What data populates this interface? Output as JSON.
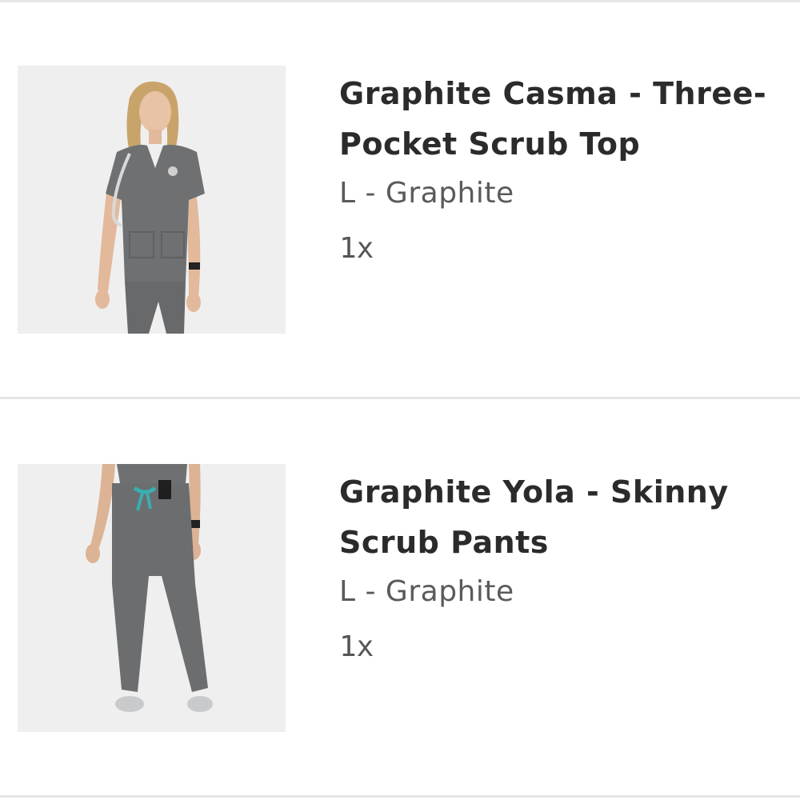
{
  "cart": {
    "items": [
      {
        "name": "Graphite Casma - Three-Pocket Scrub Top",
        "variant": "L - Graphite",
        "quantity": "1x",
        "image_icon": "scrub-top-product-photo"
      },
      {
        "name": "Graphite Yola - Skinny Scrub Pants",
        "variant": "L - Graphite",
        "quantity": "1x",
        "image_icon": "scrub-pants-product-photo"
      }
    ]
  },
  "colors": {
    "garment": "#6e7072",
    "accent_drawstring": "#3aaeb0",
    "divider": "#e6e6e6"
  }
}
